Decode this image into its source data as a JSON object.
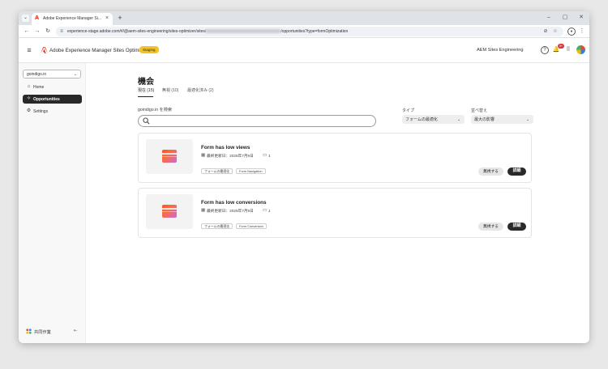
{
  "browser": {
    "tab_title": "Adobe Experience Manager Si...",
    "url_prefix": "experience-stage.adobe.com/#/@aem-sites-engineering/sites-optimizer/sites/",
    "url_suffix": "/opportunities?type=formOptimization"
  },
  "header": {
    "product": "Adobe Experience Manager Sites Optimizer",
    "env_badge": "Staging",
    "org": "AEM Sites Engineering",
    "notifications": "9+"
  },
  "sidebar": {
    "site": "goindigo.in",
    "items": [
      {
        "label": "Home"
      },
      {
        "label": "Opportunities"
      },
      {
        "label": "Settings"
      }
    ],
    "collab_label": "共同作業"
  },
  "main": {
    "title": "機会",
    "tabs": [
      {
        "label": "現在 (15)"
      },
      {
        "label": "無視 (10)"
      },
      {
        "label": "最適化済み (2)"
      }
    ],
    "search_label": "goindigo.in を検索",
    "search_value": "",
    "type_filter": {
      "label": "タイプ",
      "value": "フォームの最適化"
    },
    "sort_filter": {
      "label": "並べ替え",
      "value": "最大の影響"
    }
  },
  "cards": [
    {
      "title": "Form has low views",
      "updated": "最終更新日：2025年7月9日",
      "comments": "1",
      "tags": [
        "フォームの最適化",
        "Form Navigation"
      ],
      "ignore_label": "無視する",
      "detail_label": "詳細"
    },
    {
      "title": "Form has low conversions",
      "updated": "最終更新日：2025年7月9日",
      "comments": "1",
      "tags": [
        "フォームの最適化",
        "Form Conversion"
      ],
      "ignore_label": "無視する",
      "detail_label": "詳細"
    }
  ],
  "colors": {
    "accent_dark": "#292929",
    "staging": "#f7c320",
    "adobe_red": "#eb1000"
  }
}
